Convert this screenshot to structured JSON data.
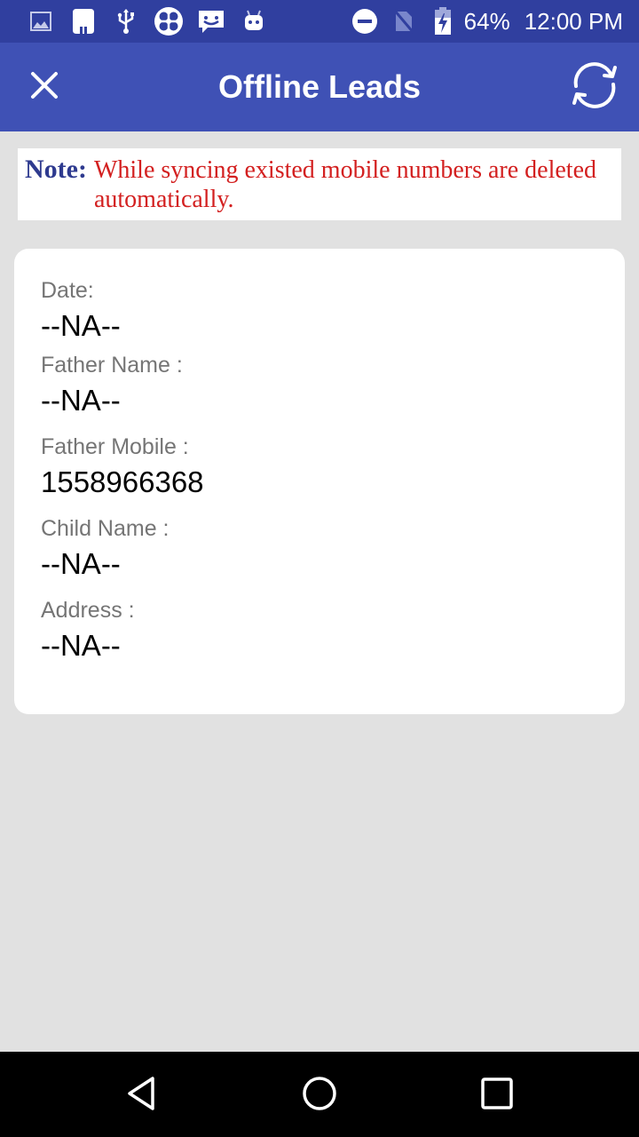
{
  "status_bar": {
    "left_icons": [
      "gallery-icon",
      "app-tile-icon",
      "usb-icon",
      "clover-app-icon",
      "chat-bubble-icon",
      "android-icon"
    ],
    "right_icons": [
      "do-not-disturb-icon",
      "no-sim-icon",
      "battery-charging-icon"
    ],
    "battery_percent": "64%",
    "time": "12:00 PM"
  },
  "app_bar": {
    "title": "Offline Leads",
    "close_icon": "close-icon",
    "sync_icon": "sync-icon"
  },
  "note": {
    "label": "Note:",
    "text": "While syncing existed mobile numbers are deleted automatically."
  },
  "lead_card": {
    "fields": [
      {
        "label": "Date:",
        "value": "--NA--"
      },
      {
        "label": "Father Name :",
        "value": "--NA--"
      },
      {
        "label": "Father Mobile :",
        "value": "1558966368"
      },
      {
        "label": "Child Name :",
        "value": "--NA--"
      },
      {
        "label": "Address :",
        "value": "--NA--"
      }
    ]
  },
  "nav_bar": {
    "buttons": [
      "back",
      "home",
      "recents"
    ]
  },
  "colors": {
    "status_bar": "#303f9f",
    "app_bar": "#3f51b5",
    "note_label": "#2e3a8f",
    "note_text": "#d32020",
    "background": "#e1e1e1"
  }
}
